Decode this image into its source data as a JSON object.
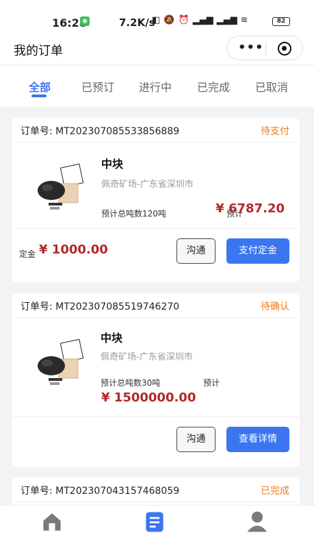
{
  "status_bar": {
    "time": "16:28",
    "speed": "7.2K/s",
    "battery": "82"
  },
  "nav": {
    "title": "我的订单",
    "more_icon": "more-dots-icon",
    "close_icon": "record-circle-icon"
  },
  "tabs": [
    {
      "label": "全部",
      "active": true
    },
    {
      "label": "已预订",
      "active": false
    },
    {
      "label": "进行中",
      "active": false
    },
    {
      "label": "已完成",
      "active": false
    },
    {
      "label": "已取消",
      "active": false
    }
  ],
  "orders": [
    {
      "order_no": "订单号: MT202307085533856889",
      "status": "待支付",
      "product_name": "中块",
      "origin": "佩奇矿场-广东省深圳市",
      "tonnage": "预计总吨数120吨",
      "est_label": "预计",
      "est_price": "¥ 6787.20",
      "deposit_label": "定金",
      "deposit_amount": "¥ 1000.00",
      "btn_chat": "沟通",
      "btn_action": "支付定金"
    },
    {
      "order_no": "订单号: MT202307085519746270",
      "status": "待确认",
      "product_name": "中块",
      "origin": "佩奇矿场-广东省深圳市",
      "tonnage": "预计总吨数30吨",
      "est_label": "预计",
      "est_price": "¥ 1500000.00",
      "btn_chat": "沟通",
      "btn_action": "查看详情"
    },
    {
      "order_no": "订单号: MT202307043157468059",
      "status": "已完成"
    }
  ],
  "bottom_tabs": [
    {
      "icon": "home-icon",
      "label": "首页"
    },
    {
      "icon": "order-list-icon",
      "label": "订单"
    },
    {
      "icon": "user-icon",
      "label": "我的"
    }
  ],
  "colors": {
    "accent": "#3b75f0",
    "status": "#f07b1a",
    "price": "#b0282b"
  }
}
